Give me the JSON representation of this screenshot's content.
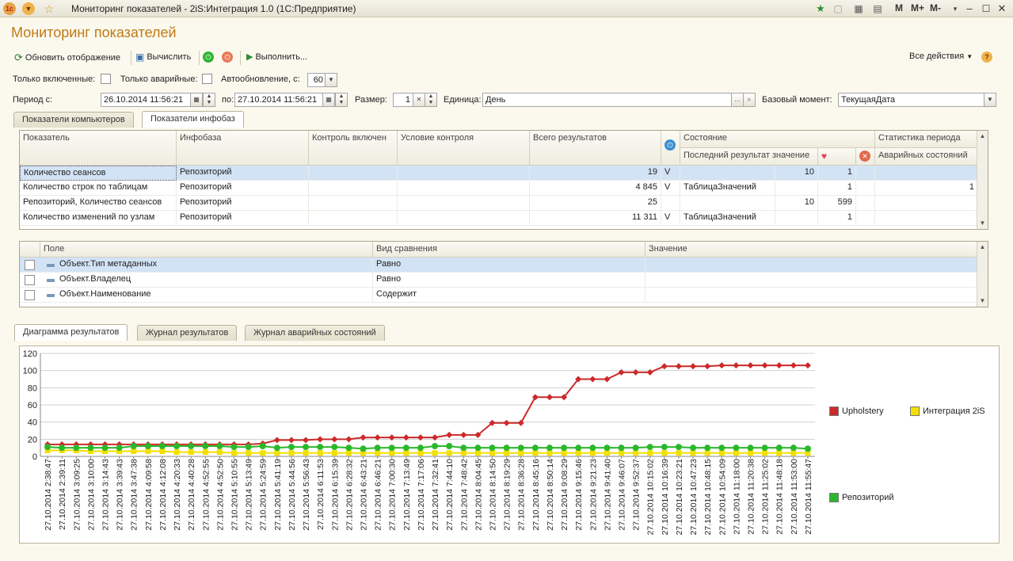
{
  "window": {
    "title": "Мониторинг показателей - 2iS:Интеграция 1.0  (1С:Предприятие)",
    "buttons": [
      "M",
      "M+",
      "M-"
    ]
  },
  "form": {
    "title": "Мониторинг показателей"
  },
  "toolbar": {
    "refresh": "Обновить отображение",
    "calculate": "Вычислить",
    "execute": "Выполнить...",
    "all_actions": "Все действия"
  },
  "filters": {
    "only_enabled": "Только включенные:",
    "only_alarm": "Только аварийные:",
    "autoupdate": "Автообновление, с:",
    "autoupdate_value": "60"
  },
  "period": {
    "from_label": "Период с:",
    "from_value": "26.10.2014 11:56:21",
    "to_label": "по:",
    "to_value": "27.10.2014 11:56:21",
    "size_label": "Размер:",
    "size_value": "1",
    "unit_label": "Единица:",
    "unit_value": "День",
    "base_label": "Базовый момент:",
    "base_value": "ТекущаяДата"
  },
  "top_tabs": [
    "Показатели компьютеров",
    "Показатели инфобаз"
  ],
  "indicators": {
    "headers": {
      "indicator": "Показатель",
      "infobase": "Инфобаза",
      "control_enabled": "Контроль включен",
      "condition": "Условие контроля",
      "total": "Всего результатов",
      "state": "Состояние",
      "last_value": "Последний результат значение",
      "period_stats": "Статистика периода",
      "alarm_states": "Аварийных состояний"
    },
    "rows": [
      {
        "indicator": "Количество сеансов",
        "infobase": "Репозиторий",
        "total": "19",
        "v": "V",
        "last": "",
        "val": "10",
        "heart": "1",
        "alarm": ""
      },
      {
        "indicator": "Количество строк по таблицам",
        "infobase": "Репозиторий",
        "total": "4 845",
        "v": "V",
        "last": "ТаблицаЗначений",
        "val": "",
        "heart": "1",
        "alarm": "1"
      },
      {
        "indicator": "Репозиторий, Количество сеансов",
        "infobase": "Репозиторий",
        "total": "25",
        "v": "",
        "last": "",
        "val": "10",
        "heart": "599",
        "alarm": ""
      },
      {
        "indicator": "Количество изменений по узлам",
        "infobase": "Репозиторий",
        "total": "11 311",
        "v": "V",
        "last": "ТаблицаЗначений",
        "val": "",
        "heart": "1",
        "alarm": ""
      }
    ]
  },
  "filter_grid": {
    "headers": {
      "field": "Поле",
      "comparison": "Вид сравнения",
      "value": "Значение"
    },
    "rows": [
      {
        "field": "Объект.Тип метаданных",
        "comparison": "Равно",
        "value": ""
      },
      {
        "field": "Объект.Владелец",
        "comparison": "Равно",
        "value": ""
      },
      {
        "field": "Объект.Наименование",
        "comparison": "Содержит",
        "value": ""
      }
    ]
  },
  "bottom_tabs": [
    "Диаграмма результатов",
    "Журнал результатов",
    "Журнал аварийных состояний"
  ],
  "chart_data": {
    "type": "line",
    "ylim": [
      0,
      120
    ],
    "y_ticks": [
      0,
      20,
      40,
      60,
      80,
      100,
      120
    ],
    "categories": [
      "27.10.2014 2:38:47",
      "27.10.2014 2:39:11",
      "27.10.2014 3:09:25",
      "27.10.2014 3:10:00",
      "27.10.2014 3:14:43",
      "27.10.2014 3:39:43",
      "27.10.2014 3:47:38",
      "27.10.2014 4:09:58",
      "27.10.2014 4:12:08",
      "27.10.2014 4:20:33",
      "27.10.2014 4:40:28",
      "27.10.2014 4:52:55",
      "27.10.2014 4:52:50",
      "27.10.2014 5:10:55",
      "27.10.2014 5:13:49",
      "27.10.2014 5:24:59",
      "27.10.2014 5:41:19",
      "27.10.2014 5:44:56",
      "27.10.2014 5:56:43",
      "27.10.2014 6:11:53",
      "27.10.2014 6:15:39",
      "27.10.2014 6:28:32",
      "27.10.2014 6:43:21",
      "27.10.2014 6:46:21",
      "27.10.2014 7:00:30",
      "27.10.2014 7:13:49",
      "27.10.2014 7:17:06",
      "27.10.2014 7:32:41",
      "27.10.2014 7:44:10",
      "27.10.2014 7:48:42",
      "27.10.2014 8:04:45",
      "27.10.2014 8:14:50",
      "27.10.2014 8:19:29",
      "27.10.2014 8:36:28",
      "27.10.2014 8:45:16",
      "27.10.2014 8:50:14",
      "27.10.2014 9:08:29",
      "27.10.2014 9:15:46",
      "27.10.2014 9:21:23",
      "27.10.2014 9:41:40",
      "27.10.2014 9:46:07",
      "27.10.2014 9:52:37",
      "27.10.2014 10:15:02",
      "27.10.2014 10:16:39",
      "27.10.2014 10:23:21",
      "27.10.2014 10:47:23",
      "27.10.2014 10:48:15",
      "27.10.2014 10:54:09",
      "27.10.2014 11:18:00",
      "27.10.2014 11:20:38",
      "27.10.2014 11:25:02",
      "27.10.2014 11:48:18",
      "27.10.2014 11:53:00",
      "27.10.2014 11:55:47"
    ],
    "series": [
      {
        "name": "Upholstery",
        "color": "#cc2a2a",
        "values": [
          14,
          14,
          14,
          14,
          14,
          14,
          14,
          14,
          14,
          14,
          14,
          14,
          14,
          14,
          14,
          15,
          19,
          19,
          19,
          20,
          20,
          20,
          22,
          22,
          22,
          22,
          22,
          22,
          25,
          25,
          25,
          39,
          39,
          39,
          69,
          69,
          69,
          90,
          90,
          90,
          98,
          98,
          98,
          105,
          105,
          105,
          105,
          106,
          106,
          106,
          106,
          106,
          106,
          106
        ]
      },
      {
        "name": "Интеграция 2iS",
        "color": "#f2e000",
        "values": [
          7,
          7,
          7,
          6,
          6,
          6,
          6,
          6,
          6,
          5,
          5,
          5,
          5,
          4,
          4,
          4,
          4,
          4,
          4,
          4,
          4,
          4,
          4,
          4,
          4,
          4,
          4,
          4,
          4,
          4,
          4,
          4,
          4,
          4,
          4,
          4,
          4,
          4,
          4,
          4,
          4,
          4,
          4,
          4,
          4,
          4,
          4,
          4,
          4,
          4,
          4,
          4,
          4,
          4
        ]
      },
      {
        "name": "Репозиторий",
        "color": "#2ab82a",
        "values": [
          11,
          10,
          10,
          10,
          10,
          10,
          12,
          12,
          12,
          12,
          12,
          12,
          12,
          11,
          11,
          12,
          10,
          11,
          11,
          11,
          11,
          10,
          9,
          10,
          10,
          10,
          10,
          12,
          12,
          10,
          10,
          10,
          10,
          10,
          10,
          10,
          10,
          10,
          10,
          10,
          10,
          10,
          11,
          11,
          11,
          10,
          10,
          10,
          10,
          10,
          10,
          10,
          10,
          9
        ]
      }
    ],
    "legend_position": "right"
  }
}
